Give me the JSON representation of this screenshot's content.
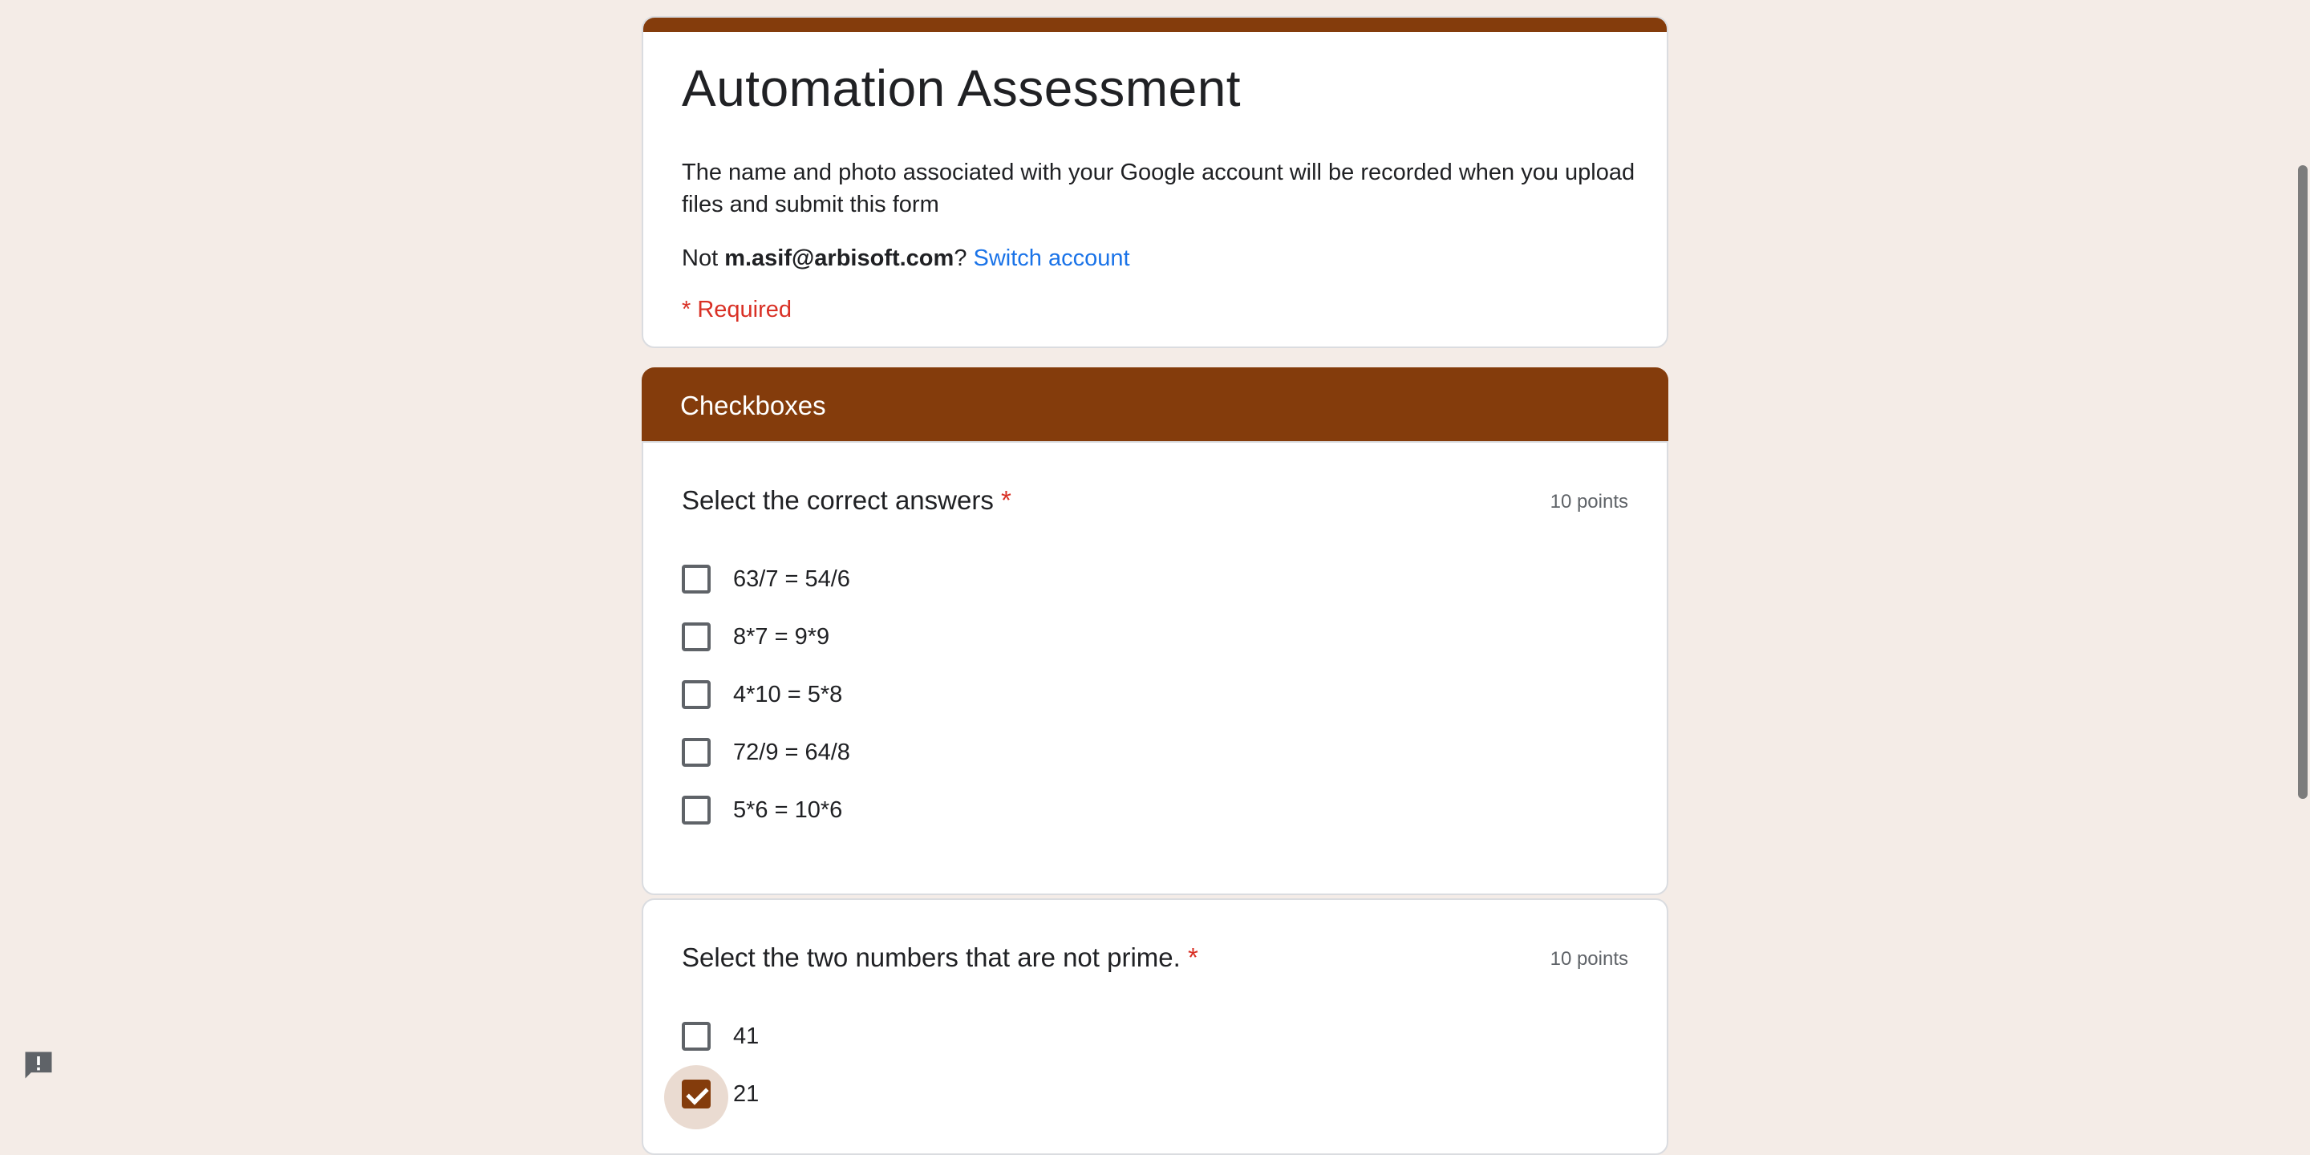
{
  "form": {
    "title": "Automation Assessment",
    "description": "The name and photo associated with your Google account will be recorded when you upload files and submit this form",
    "account_prefix": "Not ",
    "account_email": "m.asif@arbisoft.com",
    "account_suffix": "? ",
    "switch_account": "Switch account",
    "required_note": "* Required",
    "accent_color": "#843c0c",
    "background_color": "#f4ece7"
  },
  "section": {
    "title": "Checkboxes"
  },
  "questions": [
    {
      "title": "Select the correct answers",
      "required_mark": "*",
      "points": "10 points",
      "options": [
        {
          "label": "63/7 = 54/6",
          "checked": false
        },
        {
          "label": "8*7 = 9*9",
          "checked": false
        },
        {
          "label": "4*10 = 5*8",
          "checked": false
        },
        {
          "label": "72/9 = 64/8",
          "checked": false
        },
        {
          "label": "5*6 = 10*6",
          "checked": false
        }
      ]
    },
    {
      "title": "Select the two numbers that are not prime.",
      "required_mark": "*",
      "points": "10 points",
      "options": [
        {
          "label": "41",
          "checked": false
        },
        {
          "label": "21",
          "checked": true
        }
      ]
    }
  ],
  "icons": {
    "feedback": "report-feedback-icon"
  }
}
